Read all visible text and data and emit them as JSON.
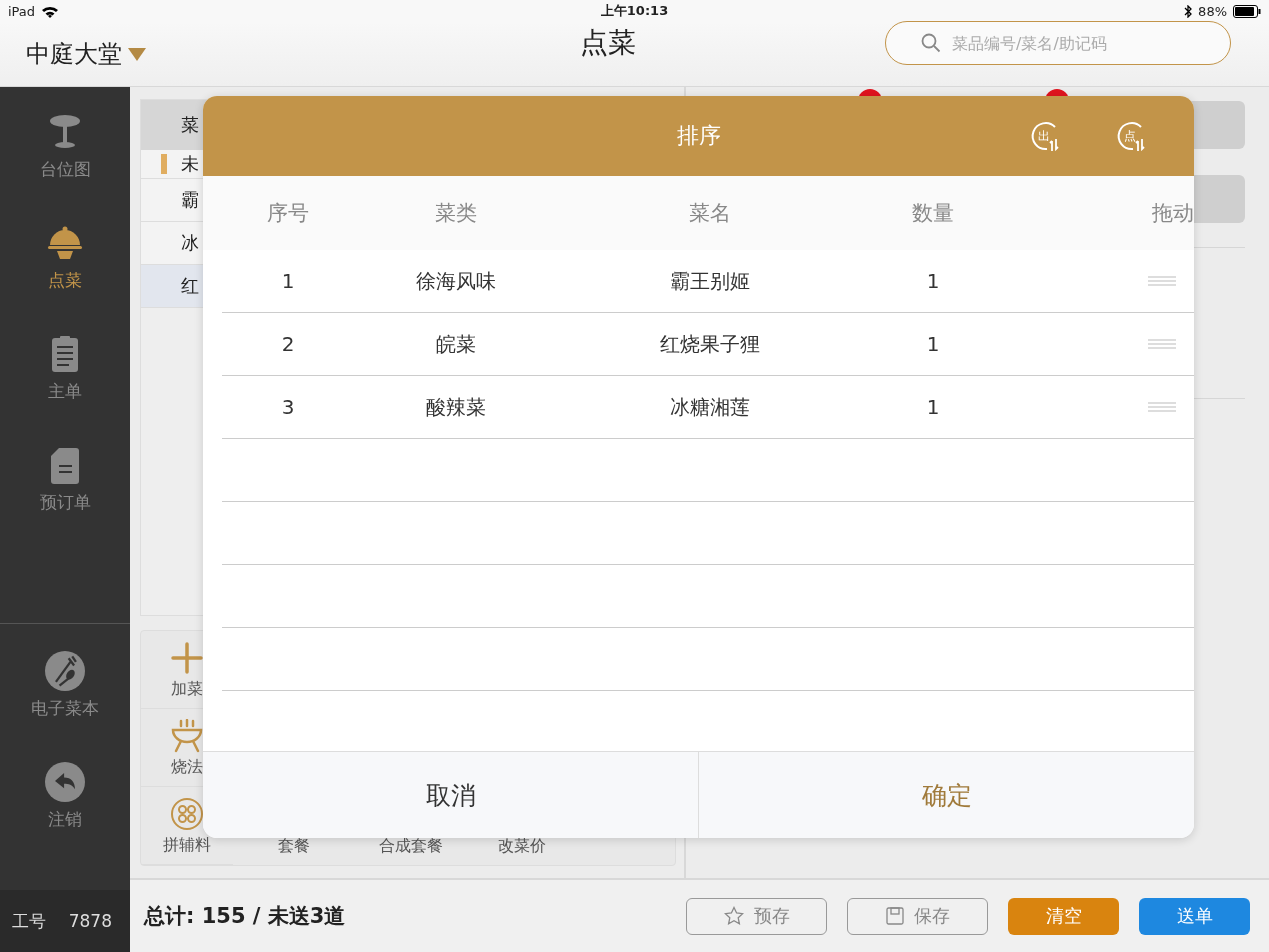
{
  "status_bar": {
    "device": "iPad",
    "time": "上午10:13",
    "battery": "88%"
  },
  "header": {
    "location": "中庭大堂",
    "title": "点菜",
    "search": {
      "placeholder": "菜品编号/菜名/助记码"
    }
  },
  "sidebar": {
    "items": [
      {
        "label": "台位图",
        "selected": false
      },
      {
        "label": "点菜",
        "selected": true
      },
      {
        "label": "主单",
        "selected": false
      },
      {
        "label": "预订单",
        "selected": false
      }
    ],
    "bottom_items": [
      {
        "label": "电子菜本"
      },
      {
        "label": "注销"
      }
    ],
    "staff": {
      "label": "工号",
      "value": "7878"
    }
  },
  "order_list": {
    "header": "菜",
    "rows": [
      {
        "text": "未",
        "kind": "group",
        "selected": false
      },
      {
        "text": "霸",
        "kind": "item",
        "selected": false
      },
      {
        "text": "冰",
        "kind": "item",
        "selected": false
      },
      {
        "text": "红",
        "kind": "item",
        "selected": true
      }
    ]
  },
  "tools": [
    {
      "label": "加菜"
    },
    {
      "label": "烧法"
    },
    {
      "label": "拼辅料"
    },
    {
      "label": "套餐"
    },
    {
      "label": "合成套餐"
    },
    {
      "label": "改菜价"
    }
  ],
  "modal": {
    "title": "排序",
    "header_icons": [
      "出",
      "点"
    ],
    "columns": [
      "序号",
      "菜类",
      "菜名",
      "数量",
      "拖动"
    ],
    "rows": [
      {
        "index": "1",
        "category": "徐海风味",
        "name": "霸王别姬",
        "quantity": "1"
      },
      {
        "index": "2",
        "category": "皖菜",
        "name": "红烧果子狸",
        "quantity": "1"
      },
      {
        "index": "3",
        "category": "酸辣菜",
        "name": "冰糖湘莲",
        "quantity": "1"
      }
    ],
    "cancel": "取消",
    "confirm": "确定"
  },
  "footer": {
    "summary": "总计: 155 / 未送3道",
    "buttons": [
      {
        "label": "预存",
        "kind": "outline"
      },
      {
        "label": "保存",
        "kind": "outline"
      },
      {
        "label": "清空",
        "kind": "warning"
      },
      {
        "label": "送单",
        "kind": "primary"
      }
    ]
  }
}
